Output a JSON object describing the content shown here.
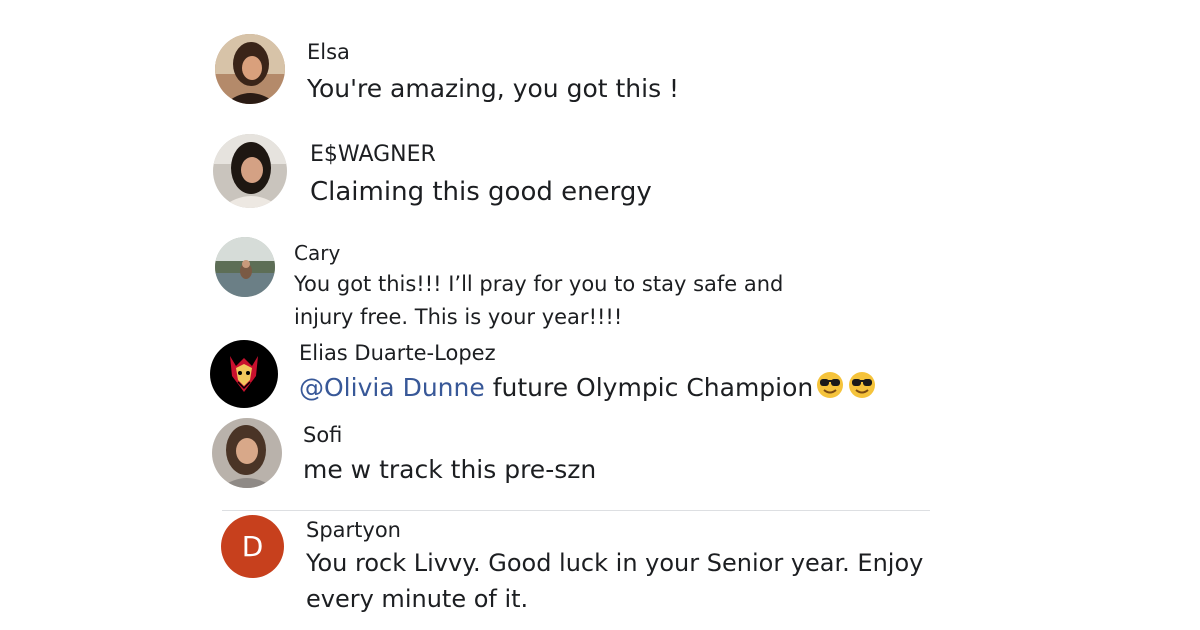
{
  "comments": [
    {
      "name": "Elsa",
      "text": "You're amazing, you got this !"
    },
    {
      "name": "E$WAGNER",
      "text": "Claiming this good energy"
    },
    {
      "name": "Cary",
      "text_line1": "You got this!!! I’ll pray for you to stay safe and",
      "text_line2": "injury free. This is your year!!!!"
    },
    {
      "name": "Elias Duarte-Lopez",
      "mention": "@Olivia Dunne",
      "text": " future Olympic Champion",
      "emoji": "sunglasses-face-emoji"
    },
    {
      "name": "Sofi",
      "text": "me w track this pre-szn"
    },
    {
      "name": "Spartyon",
      "avatar_initial": "D",
      "avatar_color": "#c7401d",
      "text_line1": "You rock Livvy. Good luck in your Senior year. Enjoy",
      "text_line2": "every minute of it."
    }
  ],
  "colors": {
    "mention": "#385898",
    "text": "#1c1e21",
    "divider": "#dddfe2"
  }
}
